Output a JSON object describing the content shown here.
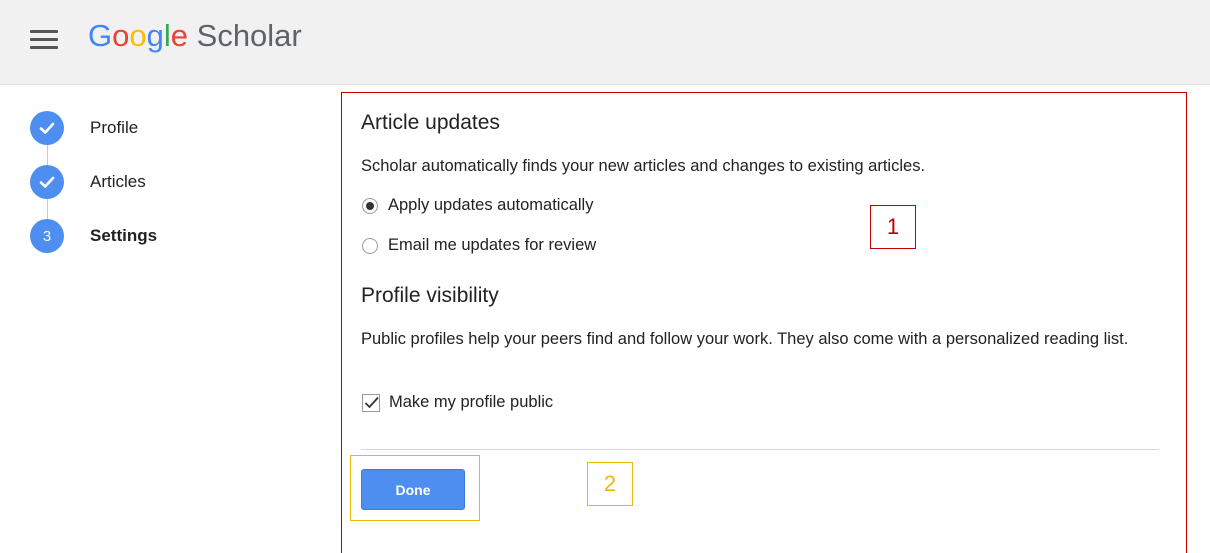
{
  "header": {
    "logo": {
      "g1": "G",
      "o1": "o",
      "o2": "o",
      "g2": "g",
      "l": "l",
      "e": "e",
      "product": "Scholar"
    }
  },
  "stepper": [
    {
      "label": "Profile",
      "state": "done",
      "number": ""
    },
    {
      "label": "Articles",
      "state": "done",
      "number": ""
    },
    {
      "label": "Settings",
      "state": "current",
      "number": "3"
    }
  ],
  "article_updates": {
    "heading": "Article updates",
    "description": "Scholar automatically finds your new articles and changes to existing articles.",
    "options": [
      {
        "label": "Apply updates automatically",
        "selected": true
      },
      {
        "label": "Email me updates for review",
        "selected": false
      }
    ]
  },
  "profile_visibility": {
    "heading": "Profile visibility",
    "description": "Public profiles help your peers find and follow your work. They also come with a personalized reading list.",
    "checkbox_label": "Make my profile public",
    "checked": true
  },
  "done_button": {
    "label": "Done"
  },
  "annotations": {
    "box1": "1",
    "box2": "2"
  },
  "colors": {
    "accent": "#4d8ef0",
    "annotation_red": "#c00000",
    "annotation_yellow": "#e8b90c"
  }
}
